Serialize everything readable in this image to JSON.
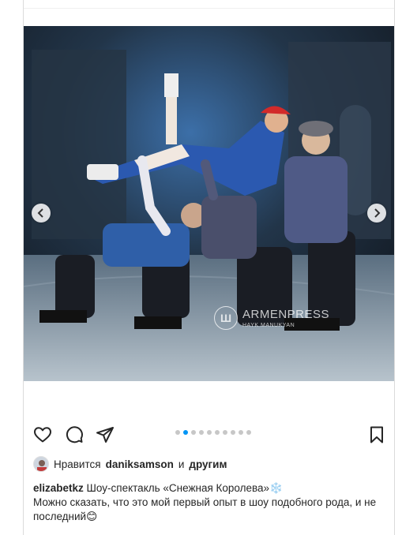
{
  "post": {
    "image_alt": "",
    "watermark": {
      "brand": "ARMENPRESS",
      "author": "HAYK MANUKYAN",
      "logo_glyph": "Ш"
    },
    "nav": {
      "prev_icon": "chevron-left-icon",
      "next_icon": "chevron-right-icon"
    },
    "carousel": {
      "total": 10,
      "active_index": 1
    },
    "actions": {
      "like_icon": "heart-icon",
      "comment_icon": "comment-bubble-icon",
      "share_icon": "paper-plane-icon",
      "save_icon": "bookmark-icon"
    },
    "likes": {
      "prefix": "Нравится",
      "user": "daniksamson",
      "connector": "и",
      "suffix": "другим"
    },
    "caption": {
      "username": "elizabetkz",
      "text": "Шоу-спектакль «Снежная Королева»❄️",
      "line2": "Можно сказать, что это мой первый опыт в шоу подобного рода, и не последний😊"
    }
  },
  "colors": {
    "accent": "#0095f6",
    "text": "#262626",
    "border": "#dbdbdb"
  }
}
